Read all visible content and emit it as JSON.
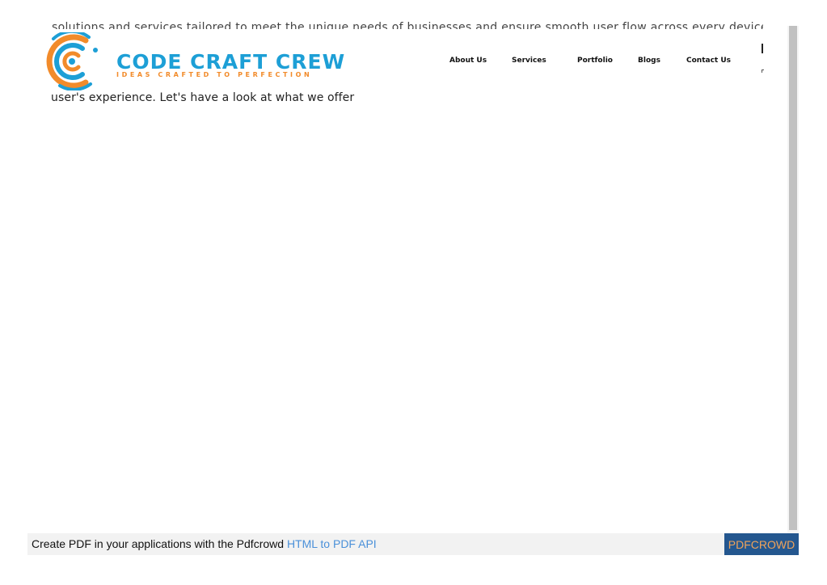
{
  "top_text_clipped": "solutions and services tailored to meet the unique needs of businesses and ensure smooth user flow across every device",
  "logo": {
    "title": "CODE CRAFT CREW",
    "tagline": "IDEAS CRAFTED TO PERFECTION",
    "colors": {
      "blue": "#1d9fd6",
      "orange": "#f28b2a"
    },
    "icon": "c-rings-logo-icon"
  },
  "nav": {
    "items": [
      {
        "label": "About Us"
      },
      {
        "label": "Services"
      },
      {
        "label": "Portfolio"
      },
      {
        "label": "Blogs"
      },
      {
        "label": "Contact Us"
      }
    ]
  },
  "content": {
    "visible_line": "user's experience. Let's have a look at what we offer"
  },
  "footer": {
    "prefix": "Create PDF in your applications with the Pdfcrowd ",
    "link": "HTML to PDF API",
    "badge": "PDFCROWD",
    "colors": {
      "bar": "#f2f2f2",
      "link": "#4a90d9",
      "badge_bg": "#24578f",
      "badge_text": "#f0a35a"
    }
  }
}
